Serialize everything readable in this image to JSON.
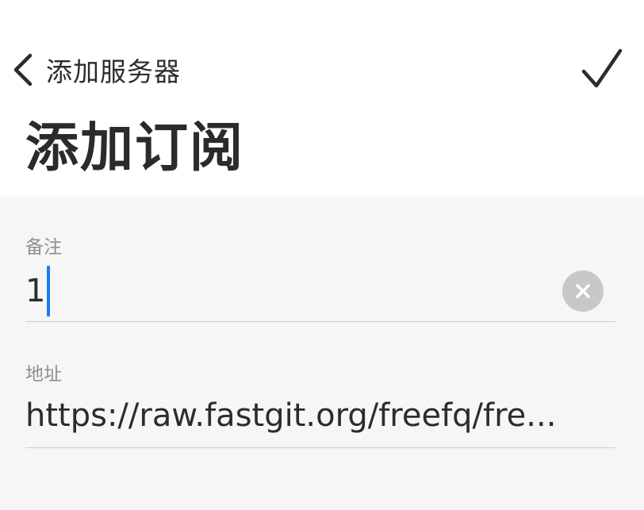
{
  "nav": {
    "back_label": "添加服务器",
    "back_icon": "chevron-left-icon",
    "confirm_icon": "checkmark-icon"
  },
  "page": {
    "title": "添加订阅"
  },
  "form": {
    "remark": {
      "label": "备注",
      "value": "1",
      "clear_icon": "clear-x-icon"
    },
    "address": {
      "label": "地址",
      "value": "https://raw.fastgit.org/freefq/fre..."
    }
  },
  "colors": {
    "header_bg": "#ffffff",
    "form_bg": "#f6f6f6",
    "caret": "#1a7bf2",
    "label": "#8e8e8e",
    "clear_button": "#c8c8c8"
  }
}
